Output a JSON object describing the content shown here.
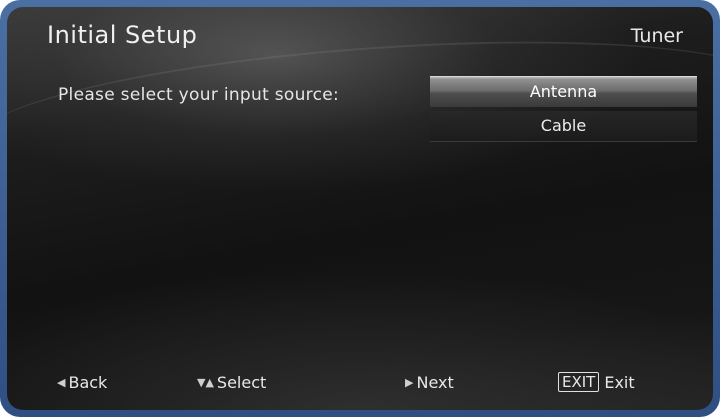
{
  "header": {
    "title": "Initial Setup",
    "section": "Tuner"
  },
  "main": {
    "prompt": "Please select your input source:",
    "options": [
      {
        "label": "Antenna",
        "selected": true
      },
      {
        "label": "Cable",
        "selected": false
      }
    ]
  },
  "footer": {
    "back_label": "Back",
    "select_label": "Select",
    "next_label": "Next",
    "exit_key": "EXIT",
    "exit_label": "Exit"
  },
  "icons": {
    "back": "left-arrow-icon",
    "select": "down-up-arrows-icon",
    "next": "right-arrow-icon"
  },
  "colors": {
    "frame": "#3d5f94",
    "screen": "#141414",
    "highlight": "#8f8f8f"
  }
}
